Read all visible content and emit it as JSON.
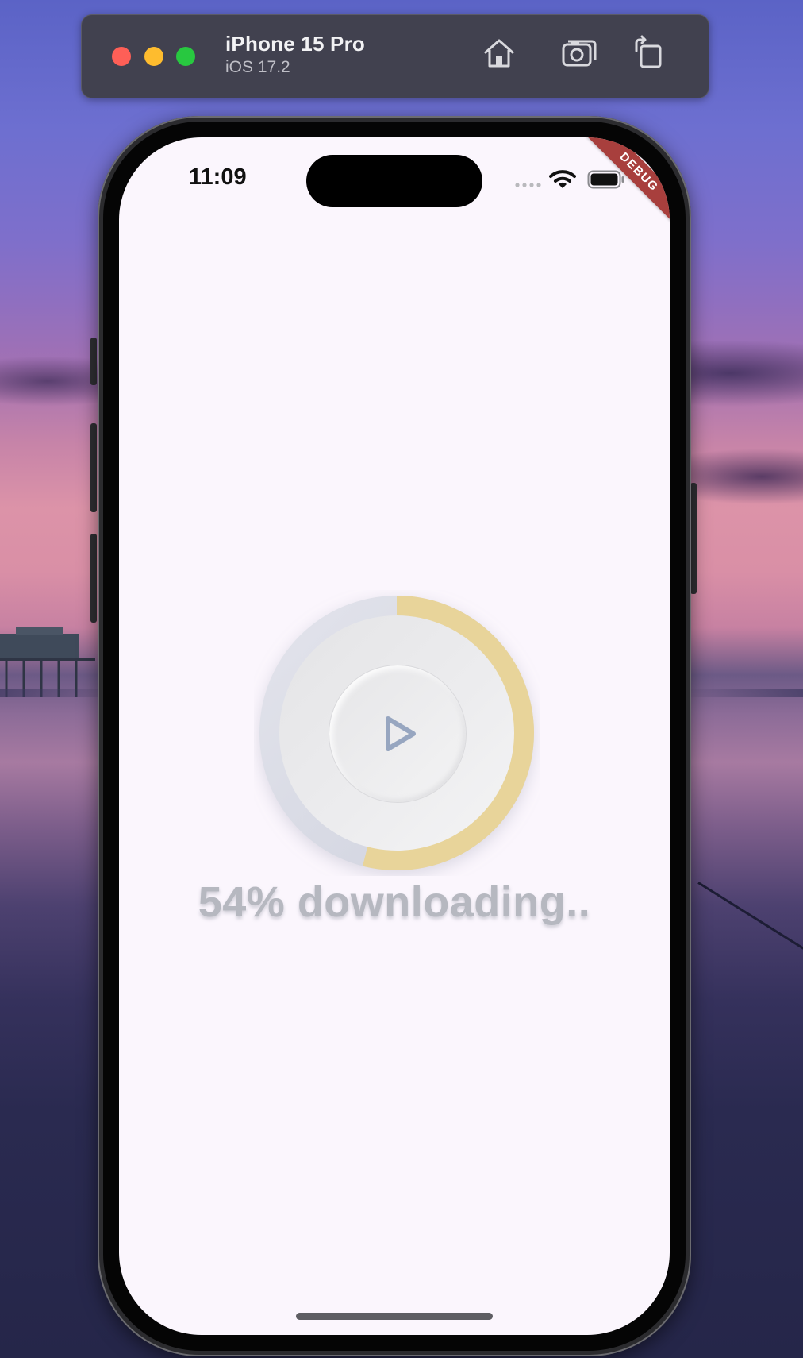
{
  "simulator": {
    "device_name": "iPhone 15 Pro",
    "os_version": "iOS 17.2",
    "toolbar_icons": [
      "home-icon",
      "screenshot-camera-icon",
      "rotate-icon"
    ]
  },
  "status_bar": {
    "time": "11:09",
    "icons": [
      "cellular-dots-icon",
      "wifi-icon",
      "battery-icon"
    ]
  },
  "debug_banner": {
    "label": "DEBUG",
    "color": "#a83f3d"
  },
  "download": {
    "progress_percent": 54,
    "label": "54% downloading..",
    "progress_color": "#e8d49a",
    "track_color": "#d8dae6",
    "play_icon": "play-icon",
    "play_icon_color": "#97a6c0"
  },
  "colors": {
    "screen_background": "#fbf6fd",
    "label_color": "#b6b8c0"
  }
}
